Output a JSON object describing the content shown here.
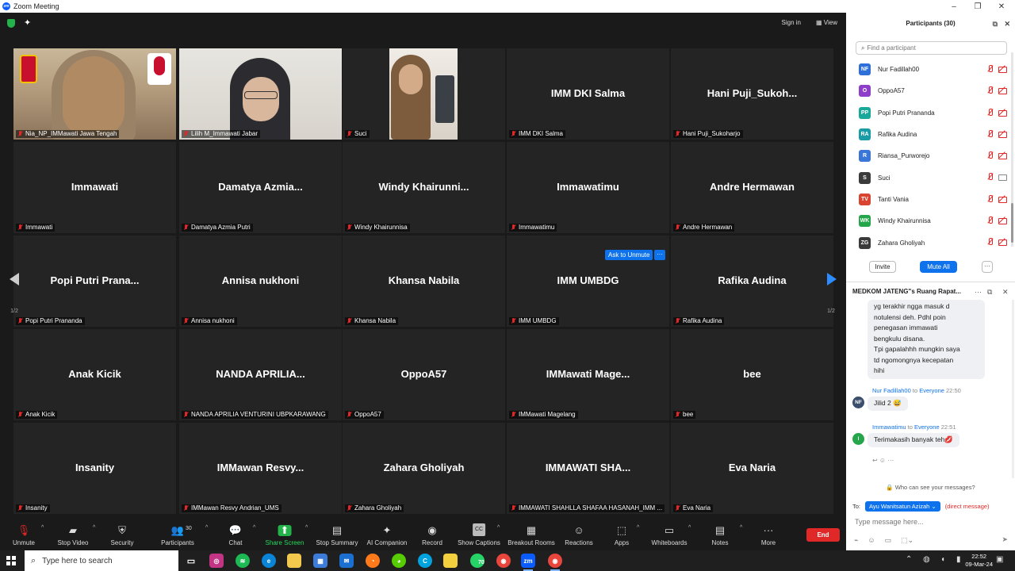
{
  "window": {
    "title": "Zoom Meeting",
    "controls": [
      "–",
      "❐",
      "✕"
    ]
  },
  "topbar": {
    "sign_in": "Sign in",
    "view": "View"
  },
  "tiles": [
    {
      "name": "",
      "label": "Nia_NP_IMMawati Jawa Tengah",
      "video": "video1",
      "active": true
    },
    {
      "name": "",
      "label": "Lilih M_Immawati Jabar",
      "video": "video2"
    },
    {
      "name": "",
      "label": "Suci",
      "video": "video3"
    },
    {
      "name": "IMM DKI Salma",
      "label": "IMM DKI Salma"
    },
    {
      "name": "Hani  Puji_Sukoh...",
      "label": "Hani Puji_Sukoharjo"
    },
    {
      "name": "Immawati",
      "label": "Immawati"
    },
    {
      "name": "Damatya  Azmia...",
      "label": "Damatya Azmia Putri"
    },
    {
      "name": "Windy  Khairunni...",
      "label": "Windy Khairunnisa"
    },
    {
      "name": "Immawatimu",
      "label": "Immawatimu"
    },
    {
      "name": "Andre Hermawan",
      "label": "Andre Hermawan"
    },
    {
      "name": "Popi Putri Prana...",
      "label": "Popi Putri Prananda"
    },
    {
      "name": "Annisa nukhoni",
      "label": "Annisa nukhoni"
    },
    {
      "name": "Khansa Nabila",
      "label": "Khansa Nabila"
    },
    {
      "name": "IMM UMBDG",
      "label": "IMM UMBDG"
    },
    {
      "name": "Rafika Audina",
      "label": "Rafika Audina"
    },
    {
      "name": "Anak Kicik",
      "label": "Anak Kicik"
    },
    {
      "name": "NANDA  APRILIA...",
      "label": "NANDA APRILIA VENTURINI UBPKARAWANG"
    },
    {
      "name": "OppoA57",
      "label": "OppoA57"
    },
    {
      "name": "IMMawati  Mage...",
      "label": "IMMawati Magelang"
    },
    {
      "name": "bee",
      "label": "bee"
    },
    {
      "name": "Insanity",
      "label": "Insanity"
    },
    {
      "name": "IMMawan  Resvy...",
      "label": "IMMawan Resvy Andrian_UMS"
    },
    {
      "name": "Zahara Gholiyah",
      "label": "Zahara Gholiyah"
    },
    {
      "name": "IMMAWATI  SHA...",
      "label": "IMMAWATI SHAHLLA SHAFAA HASANAH_IMM ..."
    },
    {
      "name": "Eva Naria",
      "label": "Eva Naria"
    }
  ],
  "ask_to_unmute": "Ask to Unmute",
  "more_dots": "···",
  "pager": {
    "left_page": "1/2",
    "right_page": "1/2"
  },
  "toolbar": {
    "items": [
      {
        "label": "Unmute",
        "icon": "mic-off-icon",
        "glyph": "🎙"
      },
      {
        "label": "Stop Video",
        "icon": "video-icon",
        "glyph": "▰"
      },
      {
        "label": "Security",
        "icon": "shield-icon",
        "glyph": "⛨"
      },
      {
        "label": "Participants",
        "icon": "people-icon",
        "glyph": "👥"
      },
      {
        "label": "Chat",
        "icon": "chat-icon",
        "glyph": "💬"
      },
      {
        "label": "Share Screen",
        "icon": "share-icon",
        "glyph": "⬆"
      },
      {
        "label": "Stop Summary",
        "icon": "summary-icon",
        "glyph": "▤"
      },
      {
        "label": "AI Companion",
        "icon": "sparkle-icon",
        "glyph": "✦"
      },
      {
        "label": "Record",
        "icon": "record-icon",
        "glyph": "◉"
      },
      {
        "label": "Show Captions",
        "icon": "captions-icon",
        "glyph": "CC"
      },
      {
        "label": "Breakout Rooms",
        "icon": "breakout-icon",
        "glyph": "▦"
      },
      {
        "label": "Reactions",
        "icon": "reactions-icon",
        "glyph": "☺"
      },
      {
        "label": "Apps",
        "icon": "apps-icon",
        "glyph": "⬚"
      },
      {
        "label": "Whiteboards",
        "icon": "whiteboard-icon",
        "glyph": "▭"
      },
      {
        "label": "Notes",
        "icon": "notes-icon",
        "glyph": "▤"
      },
      {
        "label": "More",
        "icon": "more-icon",
        "glyph": "···"
      }
    ],
    "participants_count": "30",
    "end": "End"
  },
  "participants_panel": {
    "title": "Participants (30)",
    "search_placeholder": "Find a participant",
    "people": [
      {
        "initials": "NF",
        "name": "Nur Fadillah00",
        "color": "#2f6fda",
        "cam": "off"
      },
      {
        "initials": "O",
        "name": "OppoA57",
        "color": "#8e3fc9",
        "cam": "off"
      },
      {
        "initials": "PP",
        "name": "Popi Putri Prananda",
        "color": "#19a99a",
        "cam": "off"
      },
      {
        "initials": "RA",
        "name": "Rafika Audina",
        "color": "#1a9ca6",
        "cam": "off"
      },
      {
        "initials": "R",
        "name": "Riansa_Purworejo",
        "color": "#3a76d8",
        "cam": "off"
      },
      {
        "initials": "S",
        "name": "Suci",
        "color": "#3b3b3b",
        "cam": "on"
      },
      {
        "initials": "TV",
        "name": "Tanti Vania",
        "color": "#d8442f",
        "cam": "off"
      },
      {
        "initials": "WK",
        "name": "Windy Khairunnisa",
        "color": "#25a64a",
        "cam": "off"
      },
      {
        "initials": "ZG",
        "name": "Zahara Gholiyah",
        "color": "#3b3b3b",
        "cam": "off"
      }
    ],
    "invite": "Invite",
    "mute_all": "Mute All",
    "more": "···"
  },
  "chat_panel": {
    "title": "MEDKOM JATENG\"s Ruang Rapat...",
    "message1_lines": [
      "yg terakhir ngga masuk d",
      "notulensi deh. Pdhl poin",
      "penegasan immawati",
      "bengkulu disana.",
      "Tpi gapalahhh mungkin saya",
      "td ngomongnya kecepatan",
      "hihi"
    ],
    "message2": {
      "initials": "NF",
      "from": "Nur Fadillah00",
      "to_word": "to",
      "to": "Everyone",
      "time": "22:50",
      "text": "Jilid 2 😅"
    },
    "message3": {
      "initials": "I",
      "from": "Immawatimu",
      "to_word": "to",
      "to": "Everyone",
      "time": "22:51",
      "text": "Terimakasih banyak teh💋"
    },
    "who_can_see": "Who can see your messages?",
    "to_label": "To:",
    "recipient": "Ayu Wanitsatun Azizah ⌄",
    "direct": "(direct message)",
    "placeholder": "Type message here..."
  },
  "taskbar": {
    "search": "Type here to search",
    "whatsapp_badge": "70",
    "time": "22:52",
    "date": "09-Mar-24"
  }
}
